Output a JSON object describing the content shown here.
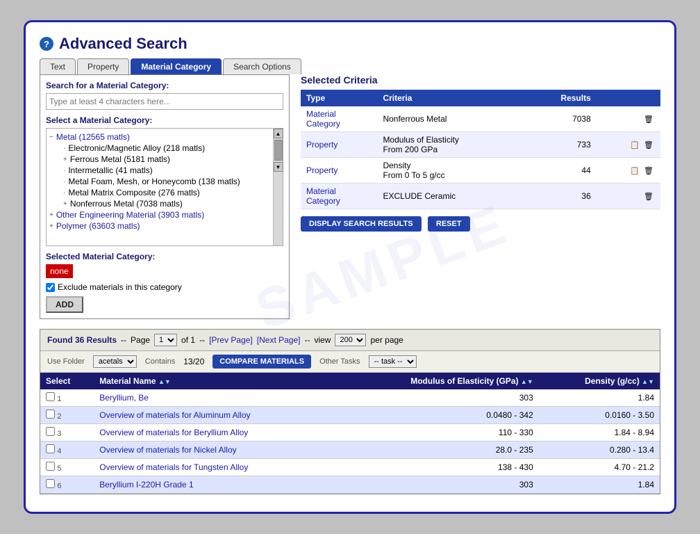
{
  "page": {
    "title": "Advanced Search",
    "help_icon": "?",
    "tabs": [
      {
        "id": "text",
        "label": "Text",
        "active": false
      },
      {
        "id": "property",
        "label": "Property",
        "active": false
      },
      {
        "id": "material-category",
        "label": "Material Category",
        "active": true
      },
      {
        "id": "search-options",
        "label": "Search Options",
        "active": false
      }
    ]
  },
  "left_panel": {
    "search_label": "Search for a Material Category:",
    "search_placeholder": "Type at least 4 characters here...",
    "select_label": "Select a Material Category:",
    "tree_items": [
      {
        "indent": 0,
        "expand": true,
        "text": "Metal (12565 matls)",
        "link": true
      },
      {
        "indent": 1,
        "expand": false,
        "text": "Electronic/Magnetic Alloy (218 matls)",
        "link": false
      },
      {
        "indent": 1,
        "expand": true,
        "text": "Ferrous Metal (5181 matls)",
        "link": false
      },
      {
        "indent": 1,
        "expand": false,
        "text": "Intermetallic (41 matls)",
        "link": false
      },
      {
        "indent": 1,
        "expand": false,
        "text": "Metal Foam, Mesh, or Honeycomb (138 matls)",
        "link": false
      },
      {
        "indent": 1,
        "expand": false,
        "text": "Metal Matrix Composite (276 matls)",
        "link": false
      },
      {
        "indent": 1,
        "expand": true,
        "text": "Nonferrous Metal (7038 matls)",
        "link": false
      },
      {
        "indent": 0,
        "expand": true,
        "text": "Other Engineering Material (3903 matls)",
        "link": true
      },
      {
        "indent": 0,
        "expand": true,
        "text": "Polymer (63603 matls)",
        "link": true
      }
    ],
    "selected_label": "Selected Material Category:",
    "selected_value": "none",
    "exclude_checked": true,
    "exclude_label": "Exclude materials in this category",
    "add_button": "ADD"
  },
  "right_panel": {
    "criteria_title": "Selected Criteria",
    "table_headers": {
      "type": "Type",
      "criteria": "Criteria",
      "results": "Results"
    },
    "criteria_rows": [
      {
        "type": "Material Category",
        "criteria": "Nonferrous Metal",
        "results": "7038"
      },
      {
        "type": "Property",
        "criteria_line1": "Modulus of Elasticity",
        "criteria_line2": "From 200 GPa",
        "results": "733",
        "has_edit": true
      },
      {
        "type": "Property",
        "criteria_line1": "Density",
        "criteria_line2": "From 0 To 5 g/cc",
        "results": "44",
        "has_edit": true
      },
      {
        "type": "Material Category",
        "criteria": "EXCLUDE Ceramic",
        "results": "36"
      }
    ],
    "display_button": "DISPLAY SEARCH RESULTS",
    "reset_button": "RESET"
  },
  "results_section": {
    "found_text": "Found 36 Results",
    "page_label": "Page",
    "page_value": "1",
    "of_text": "of 1",
    "prev_page": "[Prev Page]",
    "next_page": "[Next Page]",
    "view_label": "view",
    "view_value": "200",
    "per_page_text": "per page",
    "folder_label": "Use Folder",
    "contains_label": "Contains",
    "folder_value": "acetals",
    "contains_value": "13/20",
    "compare_button": "COMPARE MATERIALS",
    "other_tasks_label": "Other Tasks",
    "task_value": "-- task --",
    "columns": [
      {
        "id": "select",
        "label": "Select"
      },
      {
        "id": "material-name",
        "label": "Material Name"
      },
      {
        "id": "modulus",
        "label": "Modulus of Elasticity (GPa)"
      },
      {
        "id": "density",
        "label": "Density (g/cc)"
      }
    ],
    "rows": [
      {
        "num": "1",
        "name": "Beryllium, Be",
        "modulus": "303",
        "density": "1.84"
      },
      {
        "num": "2",
        "name": "Overview of materials for Aluminum Alloy",
        "modulus": "0.0480 - 342",
        "density": "0.0160 - 3.50"
      },
      {
        "num": "3",
        "name": "Overview of materials for Beryllium Alloy",
        "modulus": "110 - 330",
        "density": "1.84 - 8.94"
      },
      {
        "num": "4",
        "name": "Overview of materials for Nickel Alloy",
        "modulus": "28.0 - 235",
        "density": "0.280 - 13.4"
      },
      {
        "num": "5",
        "name": "Overview of materials for Tungsten Alloy",
        "modulus": "138 - 430",
        "density": "4.70 - 21.2"
      },
      {
        "num": "6",
        "name": "Beryllium I-220H Grade 1",
        "modulus": "303",
        "density": "1.84"
      }
    ]
  }
}
